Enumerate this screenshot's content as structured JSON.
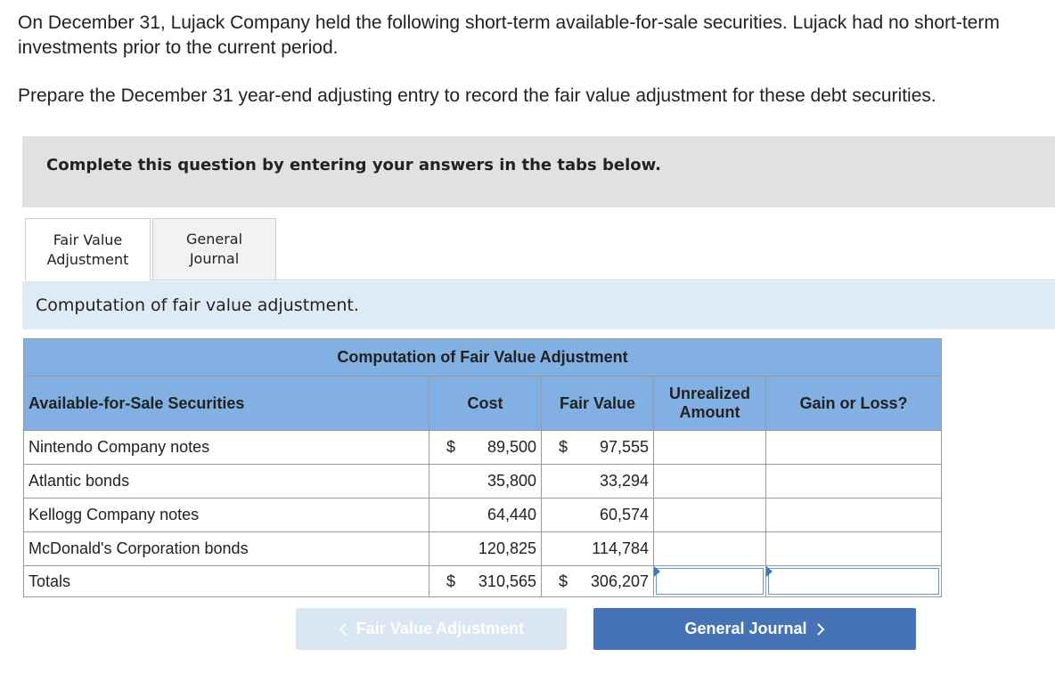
{
  "question": {
    "intro": "On December 31, Lujack Company held the following short-term available-for-sale securities. Lujack had no short-term investments prior to the current period.",
    "instruction": "Prepare the December 31 year-end adjusting entry to record the fair value adjustment for these debt securities."
  },
  "banner": {
    "text": "Complete this question by entering your answers in the tabs below."
  },
  "tabs": [
    {
      "label_line1": "Fair Value",
      "label_line2": "Adjustment",
      "active": true
    },
    {
      "label_line1": "General",
      "label_line2": "Journal",
      "active": false
    }
  ],
  "section": {
    "subtitle": "Computation of fair value adjustment."
  },
  "table": {
    "title": "Computation of Fair Value Adjustment",
    "headers": {
      "securities": "Available-for-Sale Securities",
      "cost": "Cost",
      "fair_value": "Fair Value",
      "unrealized_line1": "Unrealized",
      "unrealized_line2": "Amount",
      "gain_loss": "Gain or Loss?"
    },
    "rows": [
      {
        "name": "Nintendo Company notes",
        "cost_sign": "$",
        "cost": "89,500",
        "fv_sign": "$",
        "fair_value": "97,555"
      },
      {
        "name": "Atlantic bonds",
        "cost_sign": "",
        "cost": "35,800",
        "fv_sign": "",
        "fair_value": "33,294"
      },
      {
        "name": "Kellogg Company notes",
        "cost_sign": "",
        "cost": "64,440",
        "fv_sign": "",
        "fair_value": "60,574"
      },
      {
        "name": "McDonald's Corporation bonds",
        "cost_sign": "",
        "cost": "120,825",
        "fv_sign": "",
        "fair_value": "114,784"
      }
    ],
    "totals": {
      "name": "Totals",
      "cost_sign": "$",
      "cost": "310,565",
      "fv_sign": "$",
      "fair_value": "306,207"
    }
  },
  "nav": {
    "prev_label": "Fair Value Adjustment",
    "next_label": "General Journal"
  },
  "colors": {
    "header_blue": "#82b0e2",
    "subbar_blue": "#deebf7",
    "next_button": "#4672b6",
    "prev_button_disabled": "#dbe6f3"
  }
}
